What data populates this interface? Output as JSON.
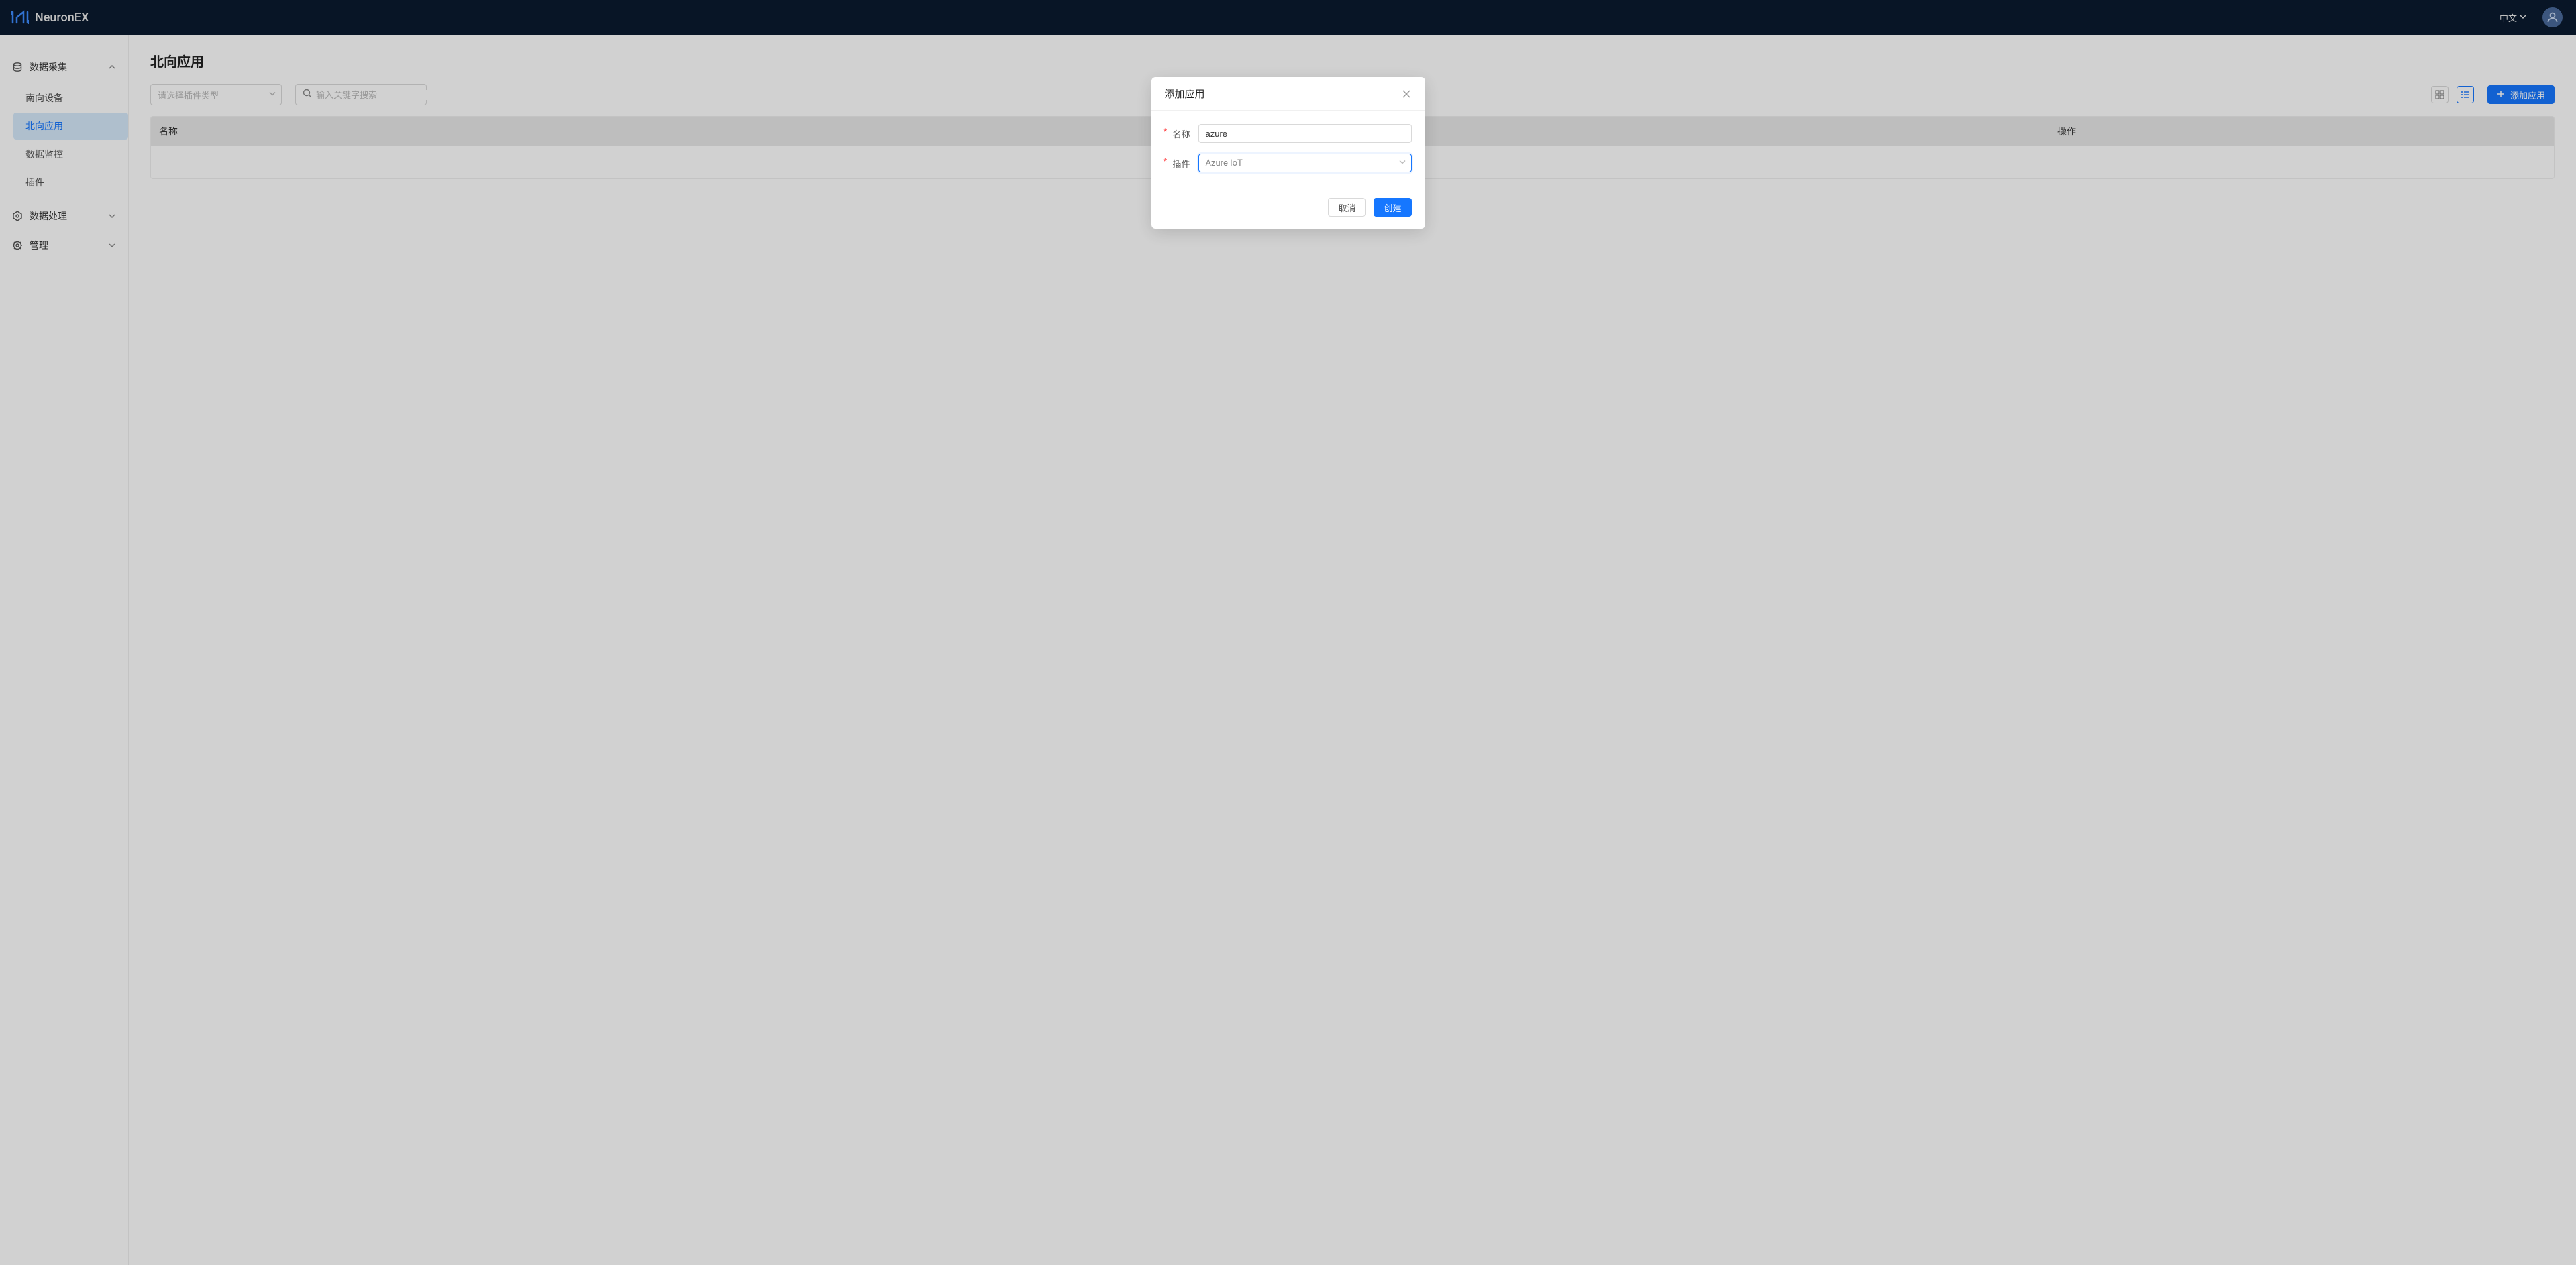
{
  "header": {
    "brand": "NeuronEX",
    "language": "中文"
  },
  "sidebar": {
    "groups": [
      {
        "label": "数据采集",
        "expanded": true,
        "items": [
          {
            "label": "南向设备",
            "active": false
          },
          {
            "label": "北向应用",
            "active": true
          },
          {
            "label": "数据监控",
            "active": false
          },
          {
            "label": "插件",
            "active": false
          }
        ]
      },
      {
        "label": "数据处理",
        "expanded": false,
        "items": []
      },
      {
        "label": "管理",
        "expanded": false,
        "items": []
      }
    ]
  },
  "main": {
    "title": "北向应用",
    "plugin_select_placeholder": "请选择插件类型",
    "search_placeholder": "输入关键字搜索",
    "add_button": "添加应用",
    "table": {
      "columns": {
        "name": "名称",
        "action": "操作"
      }
    }
  },
  "modal": {
    "title": "添加应用",
    "fields": {
      "name": {
        "label": "名称",
        "value": "azure"
      },
      "plugin": {
        "label": "插件",
        "value": "Azure IoT"
      }
    },
    "buttons": {
      "cancel": "取消",
      "create": "创建"
    }
  }
}
